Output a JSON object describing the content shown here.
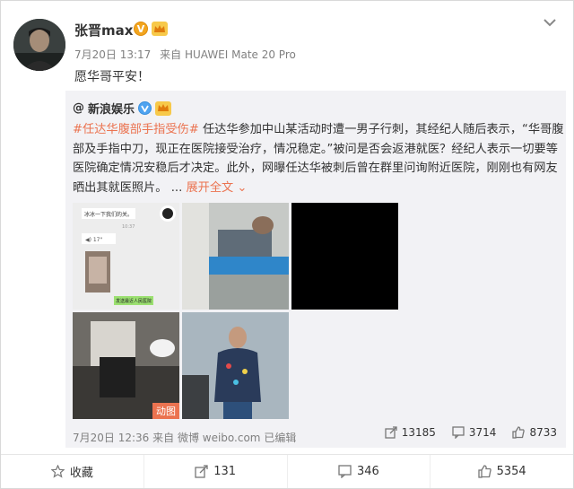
{
  "post": {
    "author": "张晋max",
    "meta_date": "7月20日 13:17",
    "meta_source": "来自 HUAWEI Mate 20 Pro",
    "text": "愿华哥平安！",
    "avatar_icon": "avatar-photo",
    "badge_v": "V"
  },
  "repost": {
    "at": "@",
    "author": "新浪娱乐",
    "text_tag": "#任达华腹部手指受伤#",
    "text_body": " 任达华参加中山某活动时遭一男子行刺，其经纪人随后表示，“华哥腹部及手指中刀，现正在医院接受治疗，情况稳定。”被问是否会返港就医？经纪人表示一切要等医院确定情况安稳后才决定。此外，网曝任达华被刺后曾在群里问询附近医院，刚刚也有网友晒出其就医照片。 ...",
    "expand": "展开全文",
    "gif_label": "动图",
    "images": [
      {
        "name": "chat-screenshot",
        "caption": "冰冰一下我们的关。"
      },
      {
        "name": "hospital-bed-photo"
      },
      {
        "name": "black-image"
      },
      {
        "name": "incident-photo"
      },
      {
        "name": "portrait-photo"
      }
    ],
    "chat": {
      "line1": "冰冰一下我们的关。",
      "line2": "10:37",
      "voice": "17\"",
      "button": "发送最近人民医院"
    },
    "footer_date": "7月20日 12:36",
    "footer_source": "来自 微博 weibo.com",
    "footer_edit": "已编辑",
    "stats": {
      "forward": "13185",
      "comment": "3714",
      "like": "8733"
    }
  },
  "actions": {
    "collect": "收藏",
    "forward": "131",
    "comment": "346",
    "like": "5354"
  },
  "colors": {
    "accent": "#eb7350",
    "repost_bg": "#f2f2f5",
    "meta": "#808080"
  }
}
